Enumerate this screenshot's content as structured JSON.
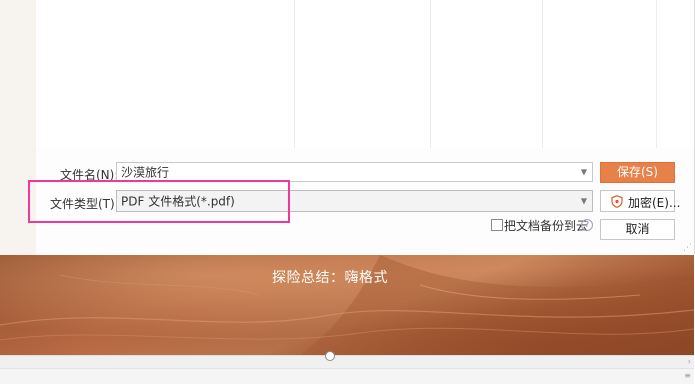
{
  "dialog": {
    "filename_label": "文件名(N):",
    "filename_value": "沙漠旅行",
    "filetype_label": "文件类型(T):",
    "filetype_value": "PDF 文件格式(*.pdf)",
    "save_label": "保存(S)",
    "encrypt_label": "加密(E)...",
    "backup_label": "把文档备份到云",
    "cancel_label": "取消",
    "help_glyph": "?"
  },
  "slide": {
    "title": "探险总结：嗨格式"
  },
  "colors": {
    "accent": "#e8804a",
    "highlight": "#f0379a",
    "encrypt_icon": "#e05a2b"
  }
}
